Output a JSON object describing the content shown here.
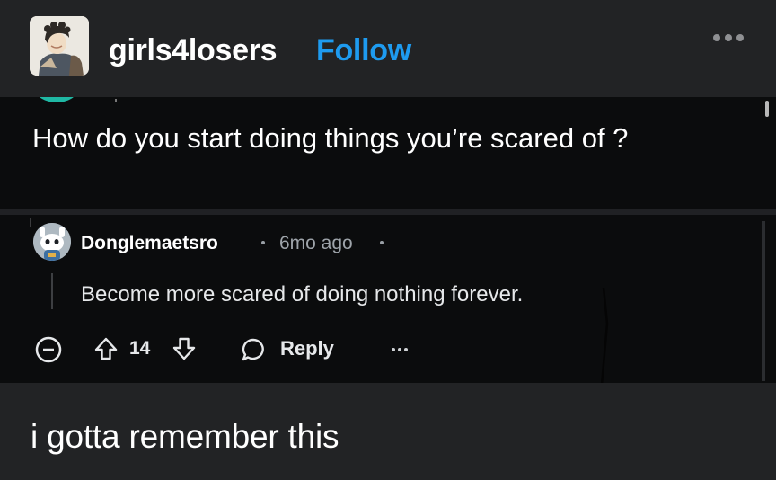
{
  "post": {
    "username": "girls4losers",
    "follow_label": "Follow",
    "avatar_icon": "user-avatar-illustration",
    "more_icon": "more-horizontal-icon"
  },
  "screenshot": {
    "question": "How do you start doing things you’re scared of ?",
    "comment": {
      "author": "Donglemaetsro",
      "time": "6mo ago",
      "body": "Become more scared of doing nothing forever.",
      "votes": "14",
      "reply_label": "Reply"
    }
  },
  "caption": "i gotta remember this",
  "colors": {
    "background": "#222325",
    "screenshot_background": "#0b0c0d",
    "follow": "#1e9bf0",
    "text": "#ffffff",
    "muted": "#9ea4aa",
    "teal_accent": "#1fb8a4"
  }
}
